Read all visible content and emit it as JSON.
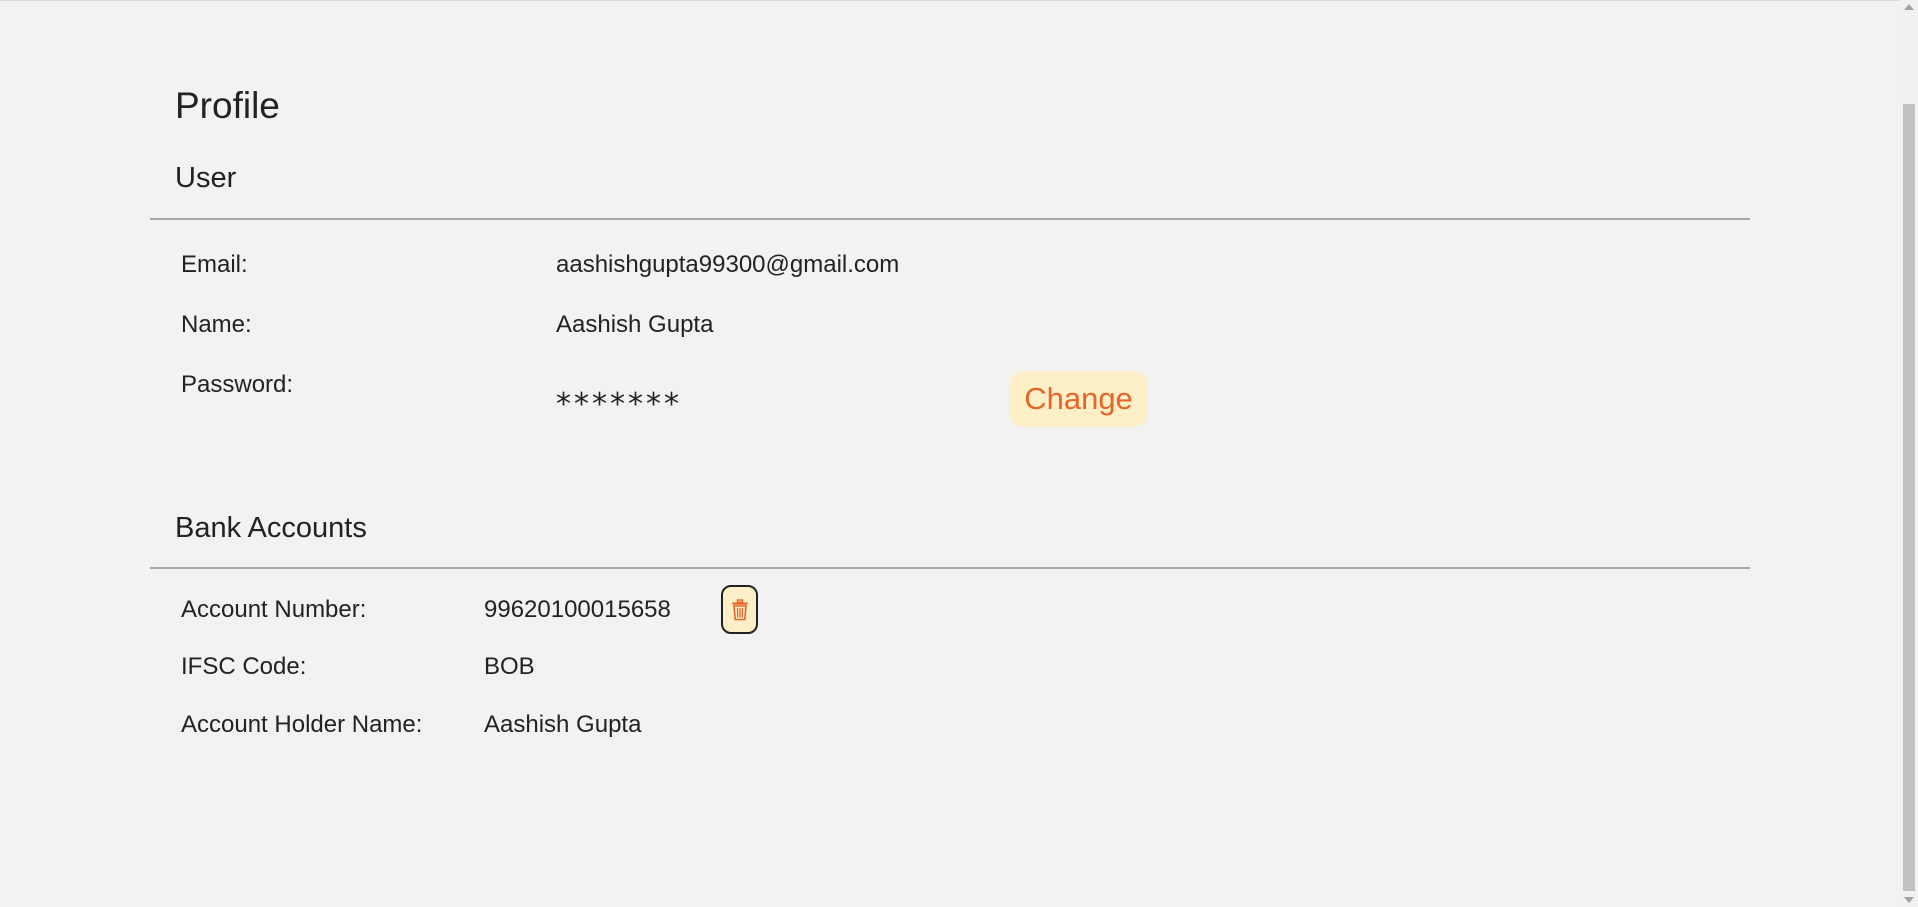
{
  "page": {
    "title": "Profile"
  },
  "user_section": {
    "title": "User",
    "email_label": "Email:",
    "email_value": "aashishgupta99300@gmail.com",
    "name_label": "Name:",
    "name_value": "Aashish Gupta",
    "password_label": "Password:",
    "password_value": "*******",
    "change_label": "Change"
  },
  "bank_section": {
    "title": "Bank Accounts",
    "account_number_label": "Account Number:",
    "account_number_value": "99620100015658",
    "ifsc_label": "IFSC Code:",
    "ifsc_value": "BOB",
    "holder_label": "Account Holder Name:",
    "holder_value": "Aashish Gupta",
    "delete_icon": "trash-icon"
  },
  "colors": {
    "background": "#f2f2f2",
    "accent": "#e8652a",
    "button_bg": "#fdf0c8",
    "divider": "#a8a8a8"
  }
}
